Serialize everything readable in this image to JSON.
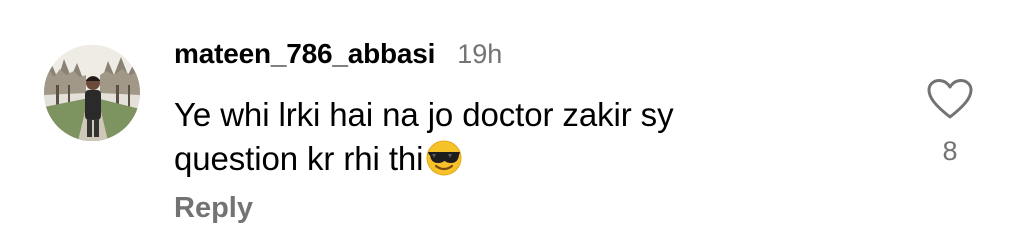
{
  "comment": {
    "username": "mateen_786_abbasi",
    "timestamp": "19h",
    "text": "Ye whi lrki hai na jo doctor zakir sy question kr rhi thi",
    "text_line1": "Ye whi lrki hai na jo doctor zakir sy",
    "text_line2": "question kr rhi thi",
    "emoji_icon": "smiling-face-with-sunglasses",
    "reply_label": "Reply",
    "like_count": "8",
    "like_icon": "heart-outline"
  }
}
